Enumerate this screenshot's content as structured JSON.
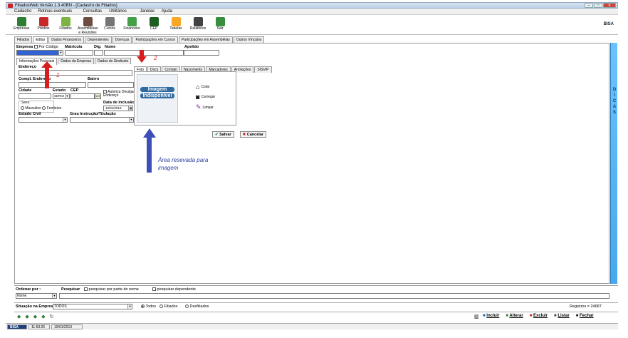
{
  "window": {
    "title": "FiliadosWeb Versão 1.3.40BN - [Cadastro de Filiados]"
  },
  "menu": [
    "Cadastro",
    "Rotinas eventuais",
    "Consultas",
    "Utilitários",
    "Janelas",
    "Ajuda"
  ],
  "toolbar": [
    {
      "label": "Empresas",
      "color": "#2e7d32"
    },
    {
      "label": "Prédios",
      "color": "#c62828"
    },
    {
      "label": "Filiados",
      "color": "#7cb342"
    },
    {
      "label": "Assembléias\ne Reuniões",
      "color": "#6d4c41"
    },
    {
      "label": "Cursos",
      "color": "#757575"
    },
    {
      "label": "Financeiro",
      "color": "#43a047"
    },
    {
      "label": "CEP",
      "color": "#1b5e20"
    },
    {
      "label": "Tabelas",
      "color": "#f9a825"
    },
    {
      "label": "Relatórios",
      "color": "#424242"
    },
    {
      "label": "Sair",
      "color": "#388e3c"
    }
  ],
  "brand": "BISA",
  "main_tabs": [
    "Filiados",
    "Editar",
    "Dados Financeiros",
    "Dependentes",
    "Doenças",
    "Participações em Cursos",
    "Participações em Assembléias",
    "Outros Vínculos"
  ],
  "form": {
    "empresa": "Empresa",
    "por_codigo": "Por Código",
    "matricula": "Matrícula",
    "dig": "Dig.",
    "nome": "Nome",
    "apelido": "Apelido",
    "sub_tabs": [
      "Informações Pessoais",
      "Dados da Empresa",
      "Dados do Sindicato"
    ],
    "endereco": "Endereço",
    "compl": "Compl. Endereço",
    "bairro": "Bairro",
    "cidade": "Cidade",
    "estado": "Estado",
    "estado_val": "SERGI",
    "cep": "CEP",
    "cep_val": "-",
    "autoriza": "Autoriza Divulgar Endereço",
    "sexo": "Sexo",
    "masculino": "Masculino",
    "feminino": "Feminino",
    "data_inclusao": "Data de inclusão",
    "data_val": "10/01/2013",
    "estado_civil": "Estado Civil",
    "grau": "Grau Instrução/Titulação"
  },
  "photo": {
    "tabs": [
      "Foto",
      "Docs",
      "Contato",
      "Nascimento",
      "Marcadores",
      "Anotações",
      "SISVIP"
    ],
    "img_line1": "Imagem",
    "img_line2": "Indisponível",
    "actions": [
      "Colar",
      "Carregar",
      "Limpar"
    ]
  },
  "buttons": {
    "save": "Salvar",
    "cancel": "Cancelar"
  },
  "annotations": {
    "n1": "1",
    "n2": "2",
    "note": "Área resevada para imagem"
  },
  "sidebar": "DICAS",
  "bottom": {
    "ordenar": "Ordenar por :",
    "ordenar_val": "Nome",
    "pesquisar": "Pesquisar",
    "parte": "pesquisar por parte do nome",
    "dependente": "pesquisar dependente",
    "situacao": "Situação na Empresa",
    "situacao_val": "TODOS",
    "todos": "Todos",
    "filiados": "Filiados",
    "desfiliados": "Desfiliados",
    "registros": "Registros = 24687"
  },
  "footer_btns": [
    "Incluir",
    "Alterar",
    "Excluir",
    "Listar",
    "Fechar"
  ],
  "status": {
    "brand": "BISA",
    "time": "11:53:26",
    "date": "10/01/2013"
  }
}
